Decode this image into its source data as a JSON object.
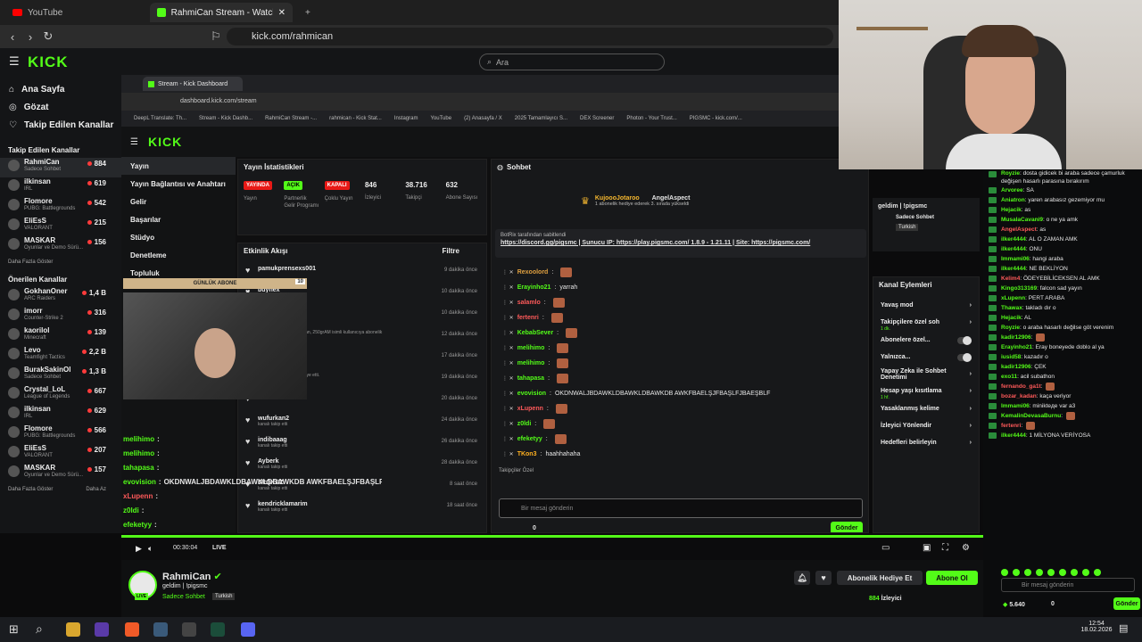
{
  "browser": {
    "tabs": [
      {
        "label": "YouTube"
      },
      {
        "label": "RahmiCan Stream - Watch Live o"
      }
    ],
    "url": "kick.com/rahmican"
  },
  "kick": {
    "search_placeholder": "Ara",
    "nav": [
      {
        "label": "Ana Sayfa"
      },
      {
        "label": "Gözat"
      },
      {
        "label": "Takip Edilen Kanallar"
      }
    ],
    "followed_header": "Takip Edilen Kanallar",
    "followed": [
      {
        "name": "RahmiCan",
        "cat": "Sadece Sohbet",
        "viewers": "884"
      },
      {
        "name": "ilkinsan",
        "cat": "IRL",
        "viewers": "619"
      },
      {
        "name": "Flomore",
        "cat": "PUBG: Battlegrounds",
        "viewers": "542"
      },
      {
        "name": "EliEsS",
        "cat": "VALORANT",
        "viewers": "215"
      },
      {
        "name": "MASKAR",
        "cat": "Oyunlar ve Demo Sürü...",
        "viewers": "156"
      }
    ],
    "show_more": "Daha Fazla Göster",
    "recommended_header": "Önerilen Kanallar",
    "recommended": [
      {
        "name": "GokhanOner",
        "cat": "ARC Raiders",
        "viewers": "1,4 B"
      },
      {
        "name": "imorr",
        "cat": "Counter-Strike 2",
        "viewers": "316"
      },
      {
        "name": "kaorilol",
        "cat": "Minecraft",
        "viewers": "139"
      },
      {
        "name": "Levo",
        "cat": "Teamfight Tactics",
        "viewers": "2,2 B"
      },
      {
        "name": "BurakSakinOl",
        "cat": "Sadece Sohbet",
        "viewers": "1,3 B"
      },
      {
        "name": "Crystal_LoL",
        "cat": "League of Legends",
        "viewers": "667"
      },
      {
        "name": "ilkinsan",
        "cat": "IRL",
        "viewers": "629"
      },
      {
        "name": "Flomore",
        "cat": "PUBG: Battlegrounds",
        "viewers": "566"
      },
      {
        "name": "EliEsS",
        "cat": "VALORANT",
        "viewers": "207"
      },
      {
        "name": "MASKAR",
        "cat": "Oyunlar ve Demo Sürü...",
        "viewers": "157"
      }
    ],
    "show_more2": "Daha Fazla Göster",
    "show_less": "Daha Az"
  },
  "inner": {
    "tab_title": "Stream - Kick Dashboard",
    "url": "dashboard.kick.com/stream",
    "bookmarks": [
      "DeepL Translate: Th...",
      "Stream - Kick Dashb...",
      "RahmiCan Stream -...",
      "rahmican - Kick Stat...",
      "Instagram",
      "YouTube",
      "(2) Anasayfa / X",
      "2025 Tamamlayıcı S...",
      "DEX Screener",
      "Photon - Your Trust...",
      "PIGSMC - kick.com/..."
    ],
    "dnav": [
      "Yayın",
      "Yayın Bağlantısı ve Anahtarı",
      "Gelir",
      "Başarılar",
      "Stüdyo",
      "Denetleme",
      "Topluluk"
    ],
    "stats_title": "Yayın İstatistikleri",
    "stats": [
      {
        "badge": "YAYINDA",
        "label": "Yayın"
      },
      {
        "badge": "AÇIK",
        "label": "Partnerlik Gelir Programı"
      },
      {
        "badge": "KAPALI",
        "label": "Çoklu Yayın"
      },
      {
        "value": "846",
        "label": "İzleyici"
      },
      {
        "value": "38.716",
        "label": "Takipçi"
      },
      {
        "value": "632",
        "label": "Abone Sayısı"
      }
    ],
    "activity_title": "Etkinlik Akışı",
    "filter": "Filtre",
    "activity": [
      {
        "user": "pamukprensexs001",
        "sub": "",
        "time": "9 dakika önce"
      },
      {
        "user": "buynex",
        "sub": "",
        "time": "10 dakika önce"
      },
      {
        "user": "",
        "sub": "yeniden abone oldu!",
        "time": "10 dakika önce"
      },
      {
        "user": "",
        "sub": "berkepolat, cagatayakman, 250grAM isimli kullanıcıya abonelik",
        "time": "12 dakika önce"
      },
      {
        "user": "",
        "sub": "",
        "time": "17 dakika önce"
      },
      {
        "user": "",
        "sub": "kullanıcıya abonelik hediye etti.",
        "time": "19 dakika önce"
      },
      {
        "user": "",
        "sub": "Link Atma silindi",
        "time": "20 dakika önce"
      },
      {
        "user": "wufurkan2",
        "sub": "kanalı takip etti",
        "time": "24 dakika önce"
      },
      {
        "user": "indibaaag",
        "sub": "kanalı takip etti",
        "time": "26 dakika önce"
      },
      {
        "user": "Ayberk",
        "sub": "kanalı takip etti",
        "time": "28 dakika önce"
      },
      {
        "user": "JRQKEZ",
        "sub": "kanalı takip etti",
        "time": "8 saat önce"
      },
      {
        "user": "kendricklamarim",
        "sub": "kanalı takip etti",
        "time": "18 saat önce"
      }
    ],
    "goal_label": "GÜNLÜK ABONE",
    "goal_value": "10",
    "chat_title": "Sohbet",
    "gift_user": "KujoooJotaroo",
    "gift_to": "AngelAspect",
    "gift_text": "1 abonelik hediye ederek 3. sırada yükseldi",
    "pinned_by": "BotRix tarafından sabitlendi",
    "pinned_text": "https://discord.gg/pigsmc | Sunucu IP: https://play.pigsmc.com/ 1.8.9 - 1.21.11 | Site: https://pigsmc.com/",
    "chat": [
      {
        "user": "Rexoolord",
        "text": "",
        "color": "#e0a040"
      },
      {
        "user": "Erayinho21",
        "text": "yarrah",
        "color": "#53fc18"
      },
      {
        "user": "salamlo",
        "text": "",
        "color": "#ff5a5a"
      },
      {
        "user": "fertenri",
        "text": "",
        "color": "#ff5a5a"
      },
      {
        "user": "KebabSever",
        "text": "",
        "color": "#53fc18"
      },
      {
        "user": "melihimo",
        "text": "",
        "color": "#53fc18"
      },
      {
        "user": "melihimo",
        "text": "",
        "color": "#53fc18"
      },
      {
        "user": "tahapasa",
        "text": "",
        "color": "#53fc18"
      },
      {
        "user": "evovision",
        "text": "OKDNWALJBDAWKLDBAWKLDBAWKDB AWKFBAELŞJFBAŞLFJBAEŞBLF",
        "color": "#53fc18"
      },
      {
        "user": "xLupenn",
        "text": "",
        "color": "#ff5a5a"
      },
      {
        "user": "z0ldi",
        "text": "",
        "color": "#53fc18"
      },
      {
        "user": "efeketyy",
        "text": "",
        "color": "#53fc18"
      },
      {
        "user": "TKon3",
        "text": "haahhahaha",
        "color": "#ffb020"
      }
    ],
    "followers_label": "Takipçiler Özel",
    "chat_placeholder": "Bir mesaj gönderin",
    "points": "0",
    "send": "Gönder",
    "kanal_title": "Kanal Eylemleri",
    "kanal": [
      "Yavaş mod",
      "Takipçilere özel soh",
      "Abonelere özel...",
      "Yalnızca...",
      "Yapay Zeka ile Sohbet Denetimi",
      "Hesap yaşı kısıtlama",
      "Yasaklanmış kelime",
      "İzleyici Yönlendir",
      "Hedefleri belirleyin"
    ],
    "kanal_sub": "1 dk.",
    "kanal_sub2": "1 hf.",
    "info_title": "geldim | !pigsmc",
    "info_cat": "Sadece Sohbet",
    "info_lang": "Turkish",
    "overlay_chat": [
      {
        "user": "melihimo",
        "text": ""
      },
      {
        "user": "melihimo",
        "text": ""
      },
      {
        "user": "tahapasa",
        "text": ""
      },
      {
        "user": "evovision",
        "text": "OKDNWALJBDAWKLDBAWKLDBAWKDB AWKFBAELŞJFBAŞLFJBAEŞBLF"
      },
      {
        "user": "xLupenn",
        "text": ""
      },
      {
        "user": "z0ldi",
        "text": ""
      },
      {
        "user": "efeketyy",
        "text": ""
      }
    ]
  },
  "player": {
    "time": "00:30:04",
    "live": "LIVE"
  },
  "channel": {
    "name": "RahmiCan",
    "title": "geldim | !pigsmc",
    "category": "Sadece Sohbet",
    "language": "Turkish",
    "live_badge": "LIVE",
    "viewers": "884",
    "viewers_label": "İzleyici",
    "gift_btn": "Abonelik Hediye Et",
    "sub_btn": "Abone Ol"
  },
  "rchat": {
    "messages": [
      {
        "user": "Royzie",
        "text": "dosta gidicek bi araba sadece çamurluk değişen hasarlı parasına bırakırım",
        "color": "#53fc18"
      },
      {
        "user": "Arvoree",
        "text": "SA",
        "color": "#53fc18"
      },
      {
        "user": "Aniatron",
        "text": "yaren arabasız gezemiyor mu",
        "color": "#53fc18"
      },
      {
        "user": "Hejacik",
        "text": "as",
        "color": "#53fc18"
      },
      {
        "user": "MusalaCavani9",
        "text": "o ne ya amk",
        "color": "#53fc18"
      },
      {
        "user": "AngelAspect",
        "text": "as",
        "color": "#ff5a5a"
      },
      {
        "user": "ilker4444",
        "text": "AL O ZAMAN AMK",
        "color": "#53fc18"
      },
      {
        "user": "ilker4444",
        "text": "ONU",
        "color": "#53fc18"
      },
      {
        "user": "Immami06",
        "text": "hangi araba",
        "color": "#53fc18"
      },
      {
        "user": "ilker4444",
        "text": "NE BEKLİYON",
        "color": "#53fc18"
      },
      {
        "user": "Kelim4",
        "text": "ÖDEYEBİLİCEKSEN AL AMK",
        "color": "#ff5a5a"
      },
      {
        "user": "Kingo313169",
        "text": "falcon sad yayın",
        "color": "#53fc18"
      },
      {
        "user": "xLupenn",
        "text": "PERT ARABA",
        "color": "#53fc18"
      },
      {
        "user": "Thawax",
        "text": "takladı dır o",
        "color": "#53fc18"
      },
      {
        "user": "Hejacik",
        "text": "AL",
        "color": "#53fc18"
      },
      {
        "user": "Royzie",
        "text": "o araba hasarlı değilse göt verenim",
        "color": "#53fc18"
      },
      {
        "user": "kadir12906",
        "text": "",
        "color": "#53fc18"
      },
      {
        "user": "Erayinho21",
        "text": "Eray boneyede doblo al ya",
        "color": "#53fc18"
      },
      {
        "user": "iusid58",
        "text": "kazadır o",
        "color": "#53fc18"
      },
      {
        "user": "kadir12906",
        "text": "ÇEK",
        "color": "#53fc18"
      },
      {
        "user": "exo11",
        "text": "acil subathon",
        "color": "#53fc18"
      },
      {
        "user": "fernando_ga1t",
        "text": "",
        "color": "#ff5a5a"
      },
      {
        "user": "bozar_kadan",
        "text": "kaça veriyor",
        "color": "#ff5a5a"
      },
      {
        "user": "Immami06",
        "text": "minikteде var a3",
        "color": "#53fc18"
      },
      {
        "user": "KemalinDevasaBurnu",
        "text": "",
        "color": "#53fc18"
      },
      {
        "user": "fertenri",
        "text": "",
        "color": "#ff5a5a"
      },
      {
        "user": "ilker4444",
        "text": "1 MİLYONA VERİYOSA",
        "color": "#53fc18"
      }
    ],
    "placeholder": "Bir mesaj gönderin",
    "points": "5.640",
    "count": "0",
    "send": "Gönder"
  },
  "taskbar": {
    "time": "12:54",
    "date": "18.02.2026"
  },
  "colors": {
    "accent": "#53fc18",
    "live": "#e91916",
    "bg": "#0b0b0c"
  }
}
